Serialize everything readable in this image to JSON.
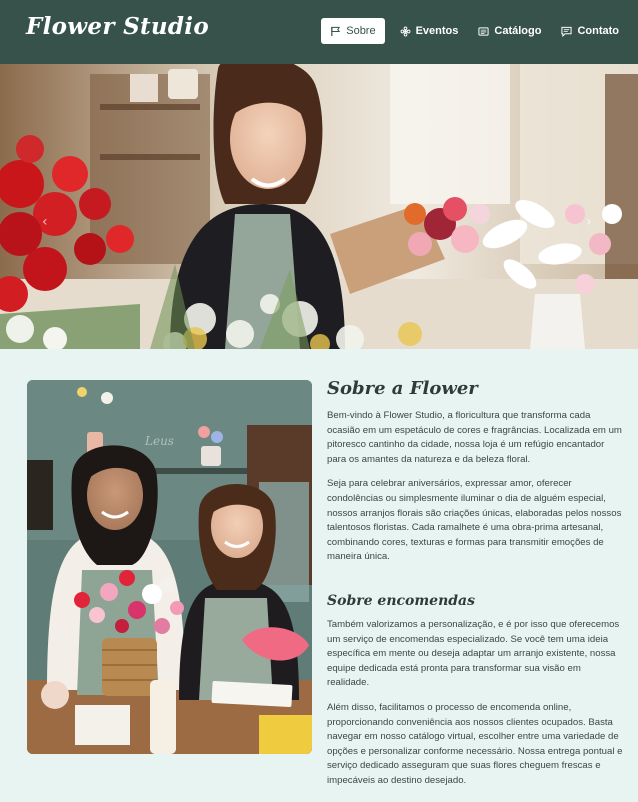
{
  "navbar": {
    "brand": "Flower Studio",
    "items": [
      {
        "label": "Sobre",
        "icon": "flag-icon",
        "active": true
      },
      {
        "label": "Eventos",
        "icon": "flower-icon",
        "active": false
      },
      {
        "label": "Catálogo",
        "icon": "catalog-icon",
        "active": false
      },
      {
        "label": "Contato",
        "icon": "message-icon",
        "active": false
      }
    ]
  },
  "hero": {
    "prev": "‹",
    "next": "›"
  },
  "about": {
    "title_bold": "Sobre",
    "title_rest": " a Flower",
    "paragraphs": [
      "Bem-vindo à Flower Studio, a floricultura que transforma cada ocasião em um espetáculo de cores e fragrâncias. Localizada em um pitoresco cantinho da cidade, nossa loja é um refúgio encantador para os amantes da natureza e da beleza floral.",
      "Seja para celebrar aniversários, expressar amor, oferecer condolências ou simplesmente iluminar o dia de alguém especial, nossos arranjos florais são criações únicas, elaboradas pelos nossos talentosos floristas. Cada ramalhete é uma obra-prima artesanal, combinando cores, texturas e formas para transmitir emoções de maneira única."
    ]
  },
  "orders": {
    "title_bold": "Sobre",
    "title_rest": " encomendas",
    "paragraphs": [
      "Também valorizamos a personalização, e é por isso que oferecemos um serviço de encomendas especializado. Se você tem uma ideia específica em mente ou deseja adaptar um arranjo existente, nossa equipe dedicada está pronta para transformar sua visão em realidade.",
      "Além disso, facilitamos o processo de encomenda online, proporcionando conveniência aos nossos clientes ocupados. Basta navegar em nosso catálogo virtual, escolher entre uma variedade de opções e personalizar conforme necessário. Nossa entrega pontual e serviço dedicado asseguram que suas flores cheguem frescas e impecáveis ao destino desejado."
    ]
  }
}
